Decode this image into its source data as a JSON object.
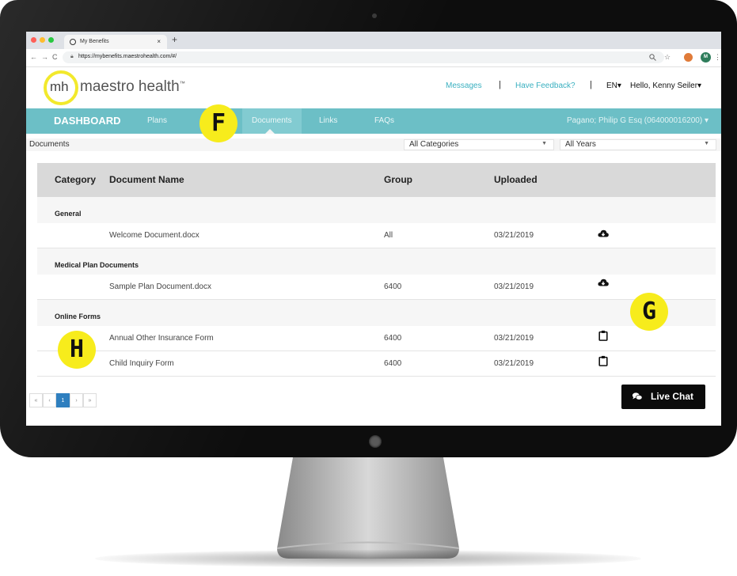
{
  "browser": {
    "tab_title": "My Benefits",
    "tab_close": "×",
    "new_tab": "+",
    "back": "←",
    "forward": "→",
    "reload": "C",
    "url": "https://mybenefits.maestrohealth.com/#/",
    "profile_initial": "M"
  },
  "header": {
    "logo_mark": "mh",
    "logo_text": "maestro health",
    "logo_tm": "™",
    "messages": "Messages",
    "feedback": "Have Feedback?",
    "separator": "|",
    "language": "EN▾",
    "greeting": "Hello, Kenny Seiler▾"
  },
  "nav": {
    "brand": "DASHBOARD",
    "items": [
      "Plans",
      "Documents",
      "Links",
      "FAQs"
    ],
    "active": "Documents",
    "account": "Pagano; Philip G Esq (064000016200) ▾"
  },
  "filters": {
    "breadcrumb": "Documents",
    "category": "All Categories",
    "year": "All Years"
  },
  "table": {
    "headers": [
      "Category",
      "Document Name",
      "Group",
      "Uploaded"
    ],
    "groups": [
      {
        "name": "General",
        "rows": [
          {
            "document": "Welcome Document.docx",
            "group": "All",
            "uploaded": "03/21/2019",
            "action": "download-icon"
          }
        ]
      },
      {
        "name": "Medical Plan Documents",
        "rows": [
          {
            "document": "Sample Plan Document.docx",
            "group": "6400",
            "uploaded": "03/21/2019",
            "action": "download-icon"
          }
        ]
      },
      {
        "name": "Online Forms",
        "rows": [
          {
            "document": "Annual Other Insurance Form",
            "group": "6400",
            "uploaded": "03/21/2019",
            "action": "clipboard-icon"
          },
          {
            "document": "Child Inquiry Form",
            "group": "6400",
            "uploaded": "03/21/2019",
            "action": "clipboard-icon"
          }
        ]
      }
    ]
  },
  "pagination": {
    "first": "«",
    "prev": "‹",
    "current": "1",
    "next": "›",
    "last": "»"
  },
  "live_chat": {
    "label": "Live Chat"
  },
  "callouts": {
    "f": "F",
    "g": "G",
    "h": "H"
  },
  "colors": {
    "nav": "#6cbfc6",
    "callout": "#f7ec1c",
    "link": "#3ab0c0",
    "page_current": "#2f7fbf"
  }
}
